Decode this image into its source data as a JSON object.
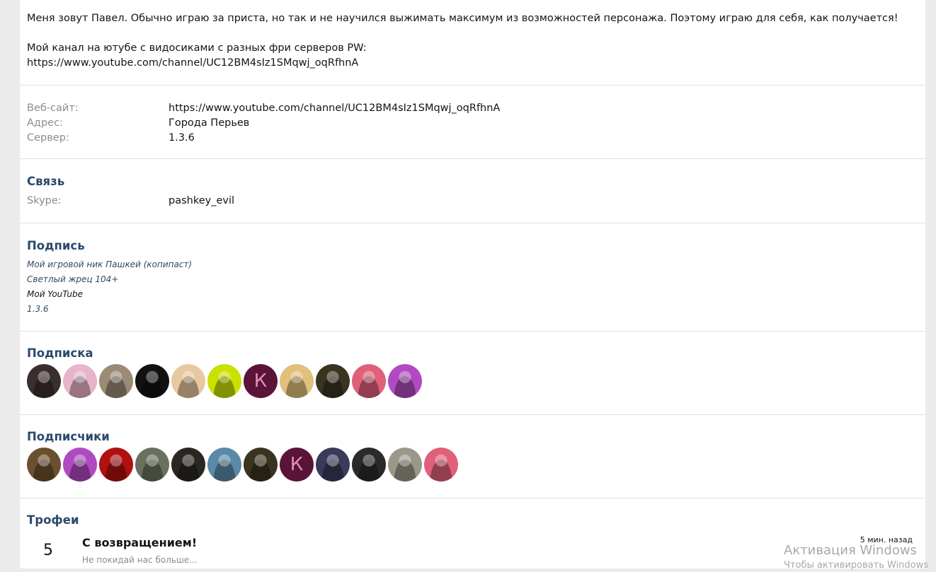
{
  "about": {
    "line1": "Меня зовут Павел. Обычно играю за приста, но так и не научился выжимать максимум из возможностей персонажа. Поэтому играю для себя, как получается!",
    "line2": "Мой канал на ютубе с видосиками с разных фри серверов PW:",
    "line3": "https://www.youtube.com/channel/UC12BM4sIz1SMqwj_oqRfhnA"
  },
  "info": {
    "website_label": "Веб-сайт:",
    "website_value": "https://www.youtube.com/channel/UC12BM4sIz1SMqwj_oqRfhnA",
    "address_label": "Адрес:",
    "address_value": "Города Перьев",
    "server_label": "Сервер:",
    "server_value": "1.3.6"
  },
  "contact": {
    "title": "Связь",
    "skype_label": "Skype:",
    "skype_value": "pashkey_evil"
  },
  "signature": {
    "title": "Подпись",
    "lines": [
      "Мой игровой ник Пашкей (копипаст)",
      "Светлый жрец 104+",
      "Мой YouTube",
      "1.3.6"
    ]
  },
  "following": {
    "title": "Подписка",
    "avatars": [
      {
        "icon": "avatar-photo",
        "color": "#3a2f2c"
      },
      {
        "icon": "avatar-anime",
        "color": "#e8b4c8"
      },
      {
        "icon": "avatar-cat",
        "color": "#9b8a76"
      },
      {
        "icon": "avatar-figure",
        "color": "#111111"
      },
      {
        "icon": "avatar-anime",
        "color": "#e8c8a0"
      },
      {
        "icon": "avatar-photo",
        "color": "#c9e000"
      },
      {
        "icon": "avatar-letter",
        "letter": "К",
        "color": "#5a1438"
      },
      {
        "icon": "avatar-anime",
        "color": "#e0c07a"
      },
      {
        "icon": "avatar-photo",
        "color": "#3a3320"
      },
      {
        "icon": "avatar-photo",
        "color": "#e0607a"
      },
      {
        "icon": "avatar-anime",
        "color": "#b04ac0"
      }
    ]
  },
  "followers": {
    "title": "Подписчики",
    "avatars": [
      {
        "icon": "avatar-photo",
        "color": "#6b5030"
      },
      {
        "icon": "avatar-anime",
        "color": "#b04ac0"
      },
      {
        "icon": "avatar-emblem",
        "color": "#b01010"
      },
      {
        "icon": "avatar-photo",
        "color": "#6a7060"
      },
      {
        "icon": "avatar-photo",
        "color": "#2a2622"
      },
      {
        "icon": "avatar-photo",
        "color": "#5a8aa8"
      },
      {
        "icon": "avatar-photo",
        "color": "#3a3320"
      },
      {
        "icon": "avatar-letter",
        "letter": "К",
        "color": "#5a1438"
      },
      {
        "icon": "avatar-anime",
        "color": "#3a3a5a"
      },
      {
        "icon": "avatar-emblem",
        "color": "#2a2a2a"
      },
      {
        "icon": "avatar-photo",
        "color": "#9a9888"
      },
      {
        "icon": "avatar-photo",
        "color": "#e0607a"
      }
    ]
  },
  "trophies": {
    "title": "Трофеи",
    "items": [
      {
        "points": "5",
        "name": "С возвращением!",
        "description": "Не покидай нас больше...",
        "time": "5 мин. назад"
      }
    ]
  },
  "watermark": {
    "title": "Активация Windows",
    "subtitle": "Чтобы активировать Windows"
  }
}
